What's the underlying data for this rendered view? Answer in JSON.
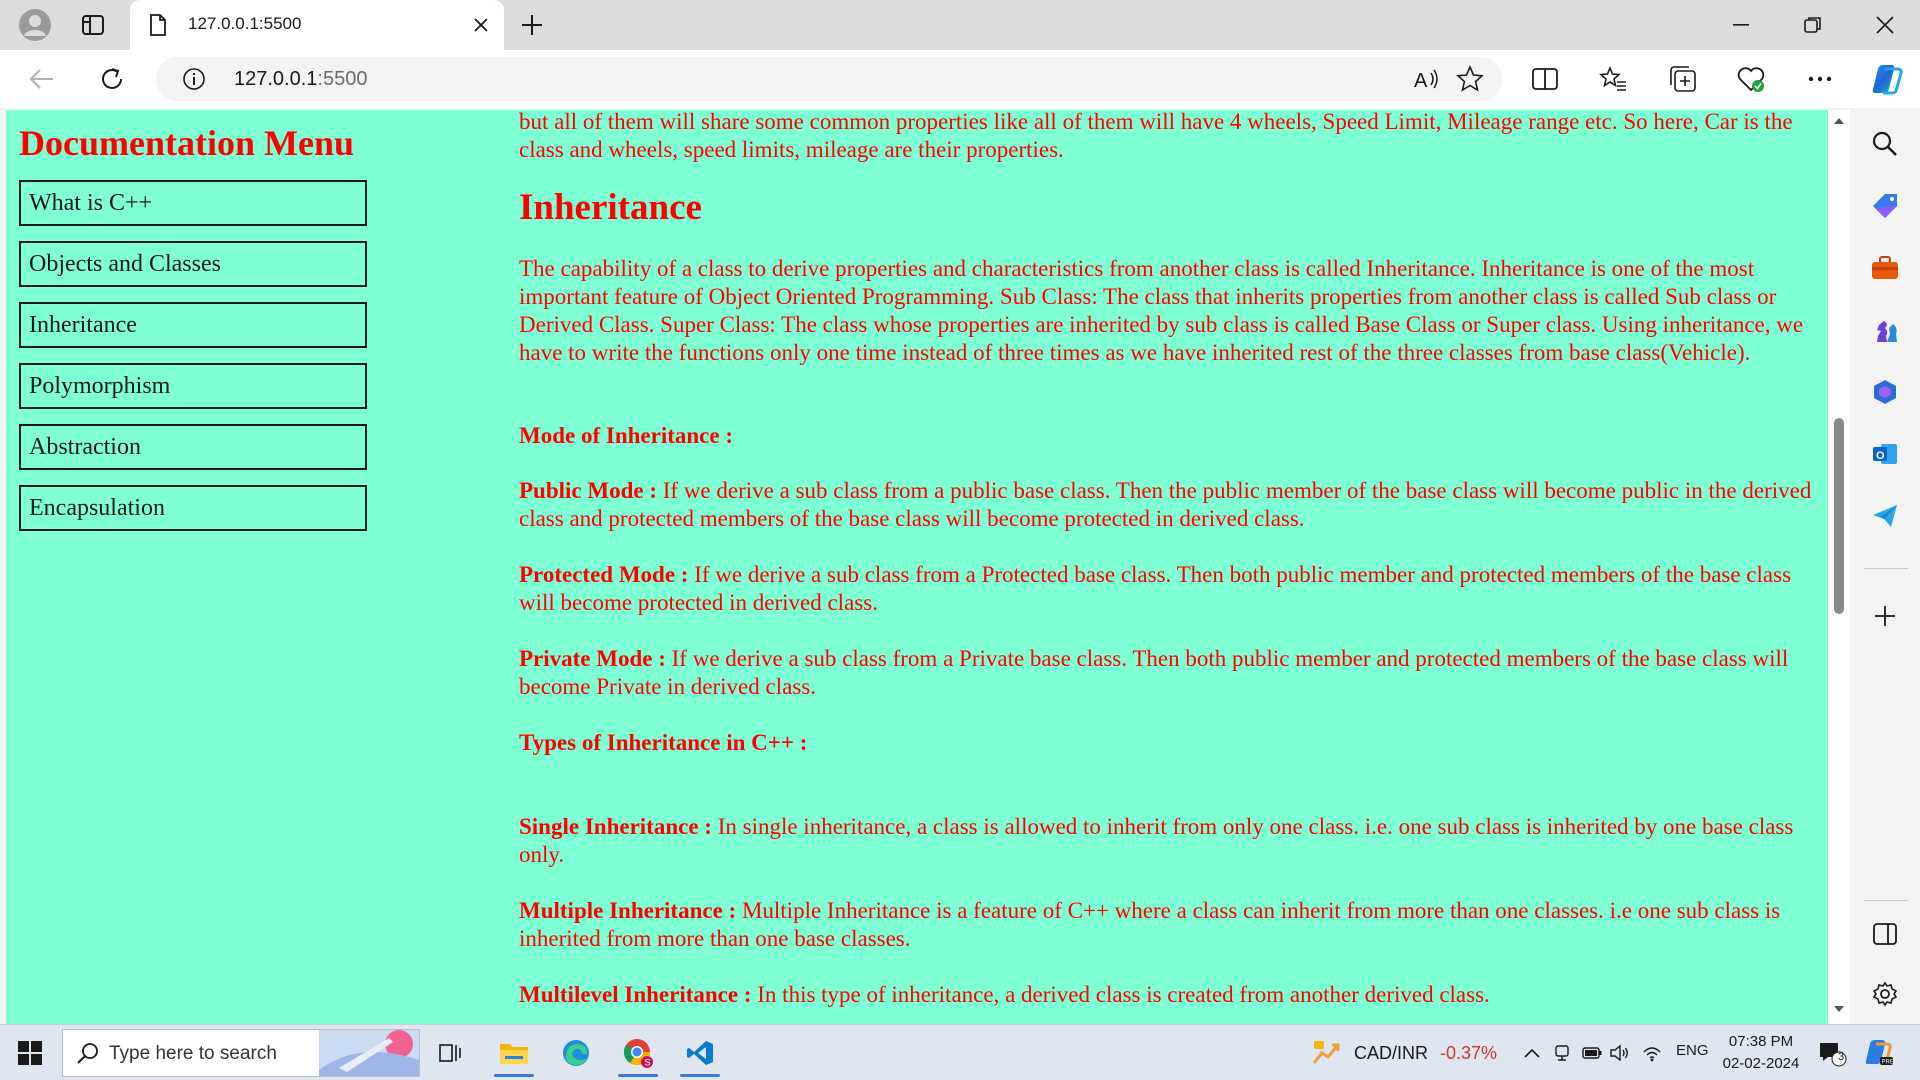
{
  "browser": {
    "tab_title": "127.0.0.1:5500",
    "url_host": "127.0.0.1",
    "url_port": ":5500"
  },
  "sidebar": {
    "title": "Documentation Menu",
    "items": [
      {
        "label": "What is C++"
      },
      {
        "label": "Objects and Classes"
      },
      {
        "label": "Inheritance"
      },
      {
        "label": "Polymorphism"
      },
      {
        "label": "Abstraction"
      },
      {
        "label": "Encapsulation"
      }
    ]
  },
  "content": {
    "intro": "but all of them will share some common properties like all of them will have 4 wheels, Speed Limit, Mileage range etc. So here, Car is the class and wheels, speed limits, mileage are their properties.",
    "heading": "Inheritance",
    "definition": "The capability of a class to derive properties and characteristics from another class is called Inheritance. Inheritance is one of the most important feature of Object Oriented Programming. Sub Class: The class that inherits properties from another class is called Sub class or Derived Class. Super Class: The class whose properties are inherited by sub class is called Base Class or Super class. Using inheritance, we have to write the functions only one time instead of three times as we have inherited rest of the three classes from base class(Vehicle).",
    "mode_heading": "Mode of Inheritance :",
    "public_label": "Public Mode :",
    "public_text": " If we derive a sub class from a public base class. Then the public member of the base class will become public in the derived class and protected members of the base class will become protected in derived class.",
    "protected_label": "Protected Mode :",
    "protected_text": " If we derive a sub class from a Protected base class. Then both public member and protected members of the base class will become protected in derived class.",
    "private_label": "Private Mode :",
    "private_text": " If we derive a sub class from a Private base class. Then both public member and protected members of the base class will become Private in derived class.",
    "types_heading": "Types of Inheritance in C++ :",
    "single_label": "Single Inheritance :",
    "single_text": " In single inheritance, a class is allowed to inherit from only one class. i.e. one sub class is inherited by one base class only.",
    "multiple_label": "Multiple Inheritance :",
    "multiple_text": " Multiple Inheritance is a feature of C++ where a class can inherit from more than one classes. i.e one sub class is inherited from more than one base classes.",
    "multilevel_label": "Multilevel Inheritance :",
    "multilevel_text": " In this type of inheritance, a derived class is created from another derived class."
  },
  "taskbar": {
    "search_placeholder": "Type here to search",
    "widget_symbol": "CAD/INR",
    "widget_change": "-0.37%",
    "language": "ENG",
    "time": "07:38 PM",
    "date": "02-02-2024",
    "notification_count": "3"
  },
  "colors": {
    "page_background": "#7fffd4",
    "text_color": "#ff0000",
    "menu_border": "#1a1a1a"
  }
}
